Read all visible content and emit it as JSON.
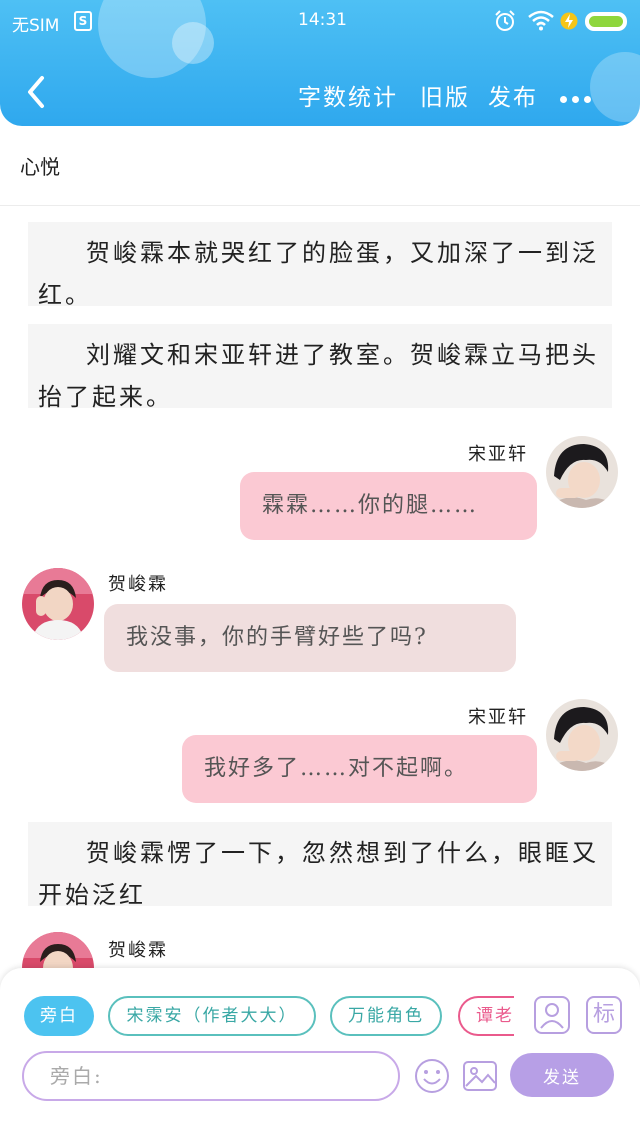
{
  "status_bar": {
    "carrier": "无SIM",
    "sim_icon_label": "S",
    "time": "14:31",
    "icons": [
      "alarm-icon",
      "wifi-icon",
      "charging-icon",
      "battery-icon"
    ],
    "battery_color": "#8fd63c"
  },
  "header": {
    "back_icon": "chevron-left-icon",
    "actions": {
      "word_count": "字数统计",
      "old_version": "旧版",
      "publish": "发布"
    },
    "more_icon": "more-dots-icon",
    "gradient": [
      "#4ec0f4",
      "#2fa8ee"
    ]
  },
  "title": "心悦",
  "story": {
    "narration_1": "贺峻霖本就哭红了的脸蛋，又加深了一到泛红。",
    "narration_2": "刘耀文和宋亚轩进了教室。贺峻霖立马把头抬了起来。",
    "chat_1": {
      "speaker": "宋亚轩",
      "text": "霖霖……你的腿……"
    },
    "chat_2": {
      "speaker": "贺峻霖",
      "text": "我没事，你的手臂好些了吗?"
    },
    "chat_3": {
      "speaker": "宋亚轩",
      "text": "我好多了……对不起啊。"
    },
    "narration_3": "贺峻霖愣了一下，忽然想到了什么，眼眶又开始泛红",
    "chat_4": {
      "speaker": "贺峻霖"
    }
  },
  "composer": {
    "chips": {
      "narrator": "旁白",
      "role_author": "宋霂安（作者大大）",
      "role_universal": "万能角色",
      "role_partial": "谭老"
    },
    "tag_button": "标",
    "input_placeholder": "旁白:",
    "send_label": "发送",
    "colors": {
      "active_chip": "#4cc3f0",
      "teal_chip": "#5ac0bd",
      "pink_chip": "#ea5a8c",
      "accent": "#b79fe6"
    }
  }
}
